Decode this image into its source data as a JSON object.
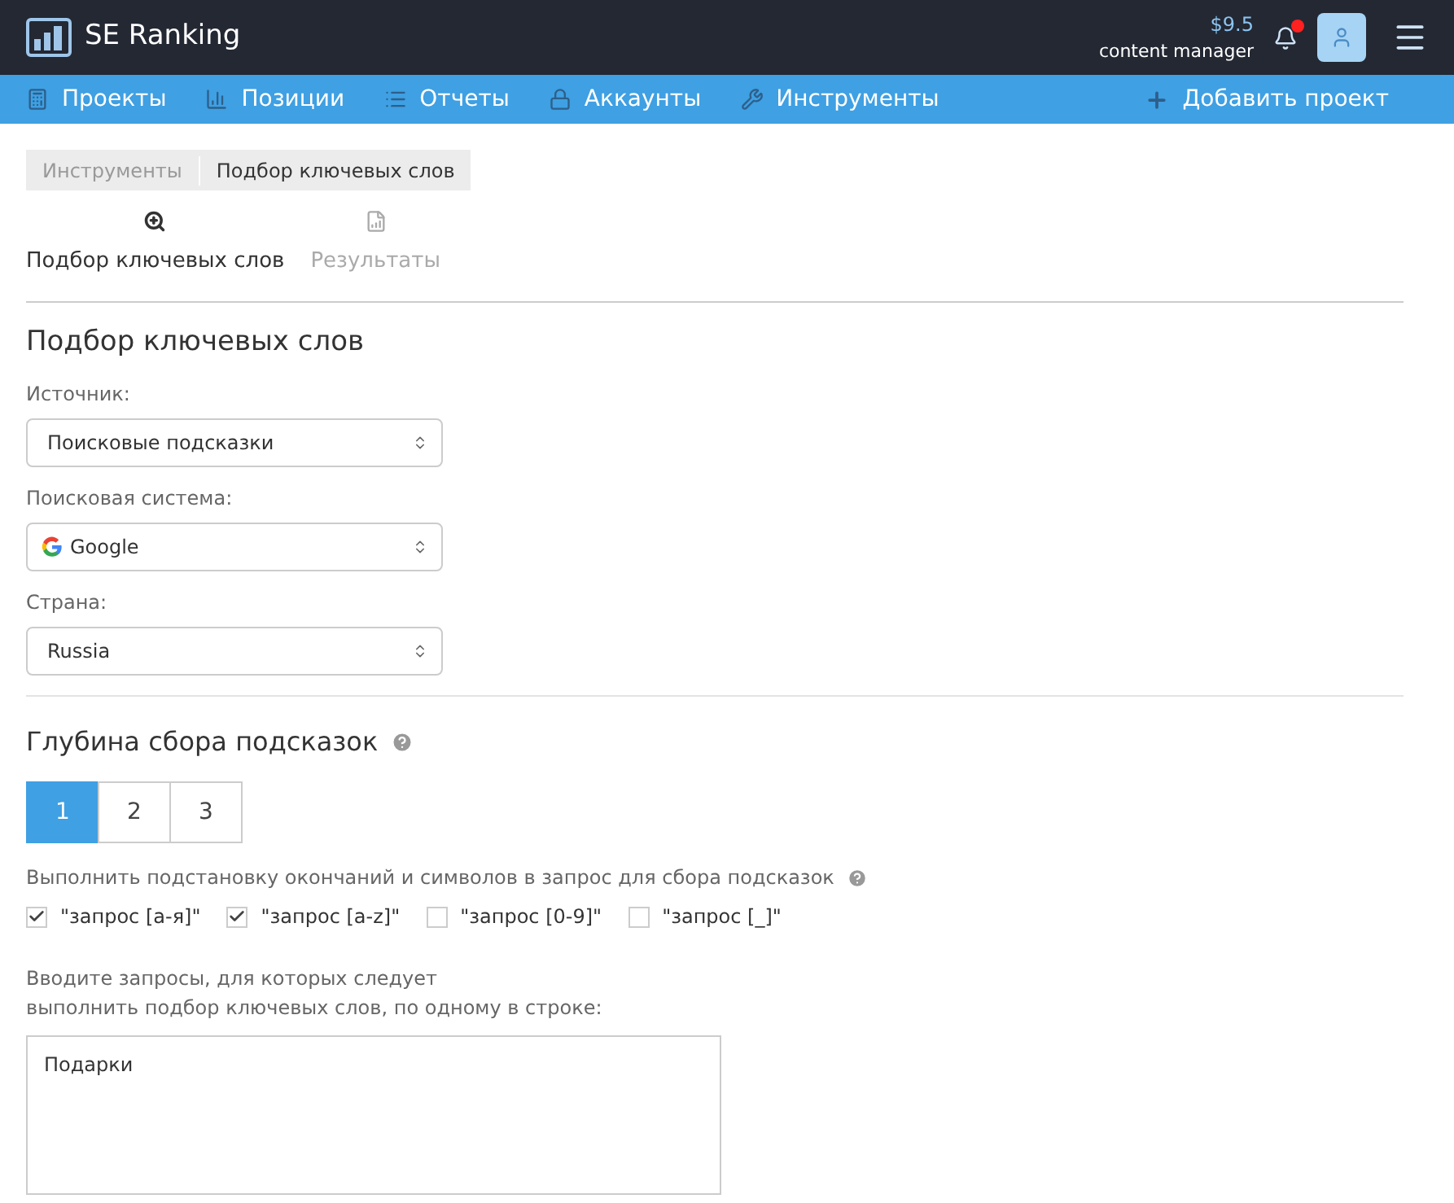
{
  "header": {
    "logo": "SE Ranking",
    "balance": "$9.5",
    "role": "content manager",
    "notification": true
  },
  "nav": [
    {
      "kind": "projects",
      "label": "Проекты"
    },
    {
      "kind": "positions",
      "label": "Позиции"
    },
    {
      "kind": "reports",
      "label": "Отчеты"
    },
    {
      "kind": "accounts",
      "label": "Аккаунты"
    },
    {
      "kind": "tools",
      "label": "Инструменты"
    }
  ],
  "add_project": "Добавить проект",
  "breadcrumb": [
    "Инструменты",
    "Подбор ключевых слов"
  ],
  "tabs": [
    {
      "kind": "search",
      "label": "Подбор ключевых слов",
      "selected": true
    },
    {
      "kind": "results",
      "label": "Результаты",
      "selected": false
    }
  ],
  "title": "Подбор ключевых слов",
  "selects": [
    {
      "label": "Источник:",
      "value": "Поисковые подсказки",
      "kind": "plain"
    },
    {
      "label": "Поисковая система:",
      "value": "Google",
      "kind": "google"
    },
    {
      "label": "Страна:",
      "value": "Russia",
      "kind": "plain"
    }
  ],
  "depth": {
    "title": "Глубина сбора подсказок",
    "options": [
      {
        "label": "1",
        "selected": true
      },
      {
        "label": "2",
        "selected": false
      },
      {
        "label": "3",
        "selected": false
      }
    ]
  },
  "substitution": {
    "label": "Выполнить подстановку окончаний и символов в запрос для сбора подсказок",
    "options": [
      {
        "label": "\"запрос [а-я]\"",
        "checked": true
      },
      {
        "label": "\"запрос [a-z]\"",
        "checked": true
      },
      {
        "label": "\"запрос [0-9]\"",
        "checked": false
      },
      {
        "label": "\"запрос [_]\"",
        "checked": false
      }
    ]
  },
  "queries": {
    "hint_1": "Вводите запросы, для которых следует",
    "hint_2": "выполнить подбор ключевых слов, по одному в строке:",
    "value": "Подарки"
  }
}
